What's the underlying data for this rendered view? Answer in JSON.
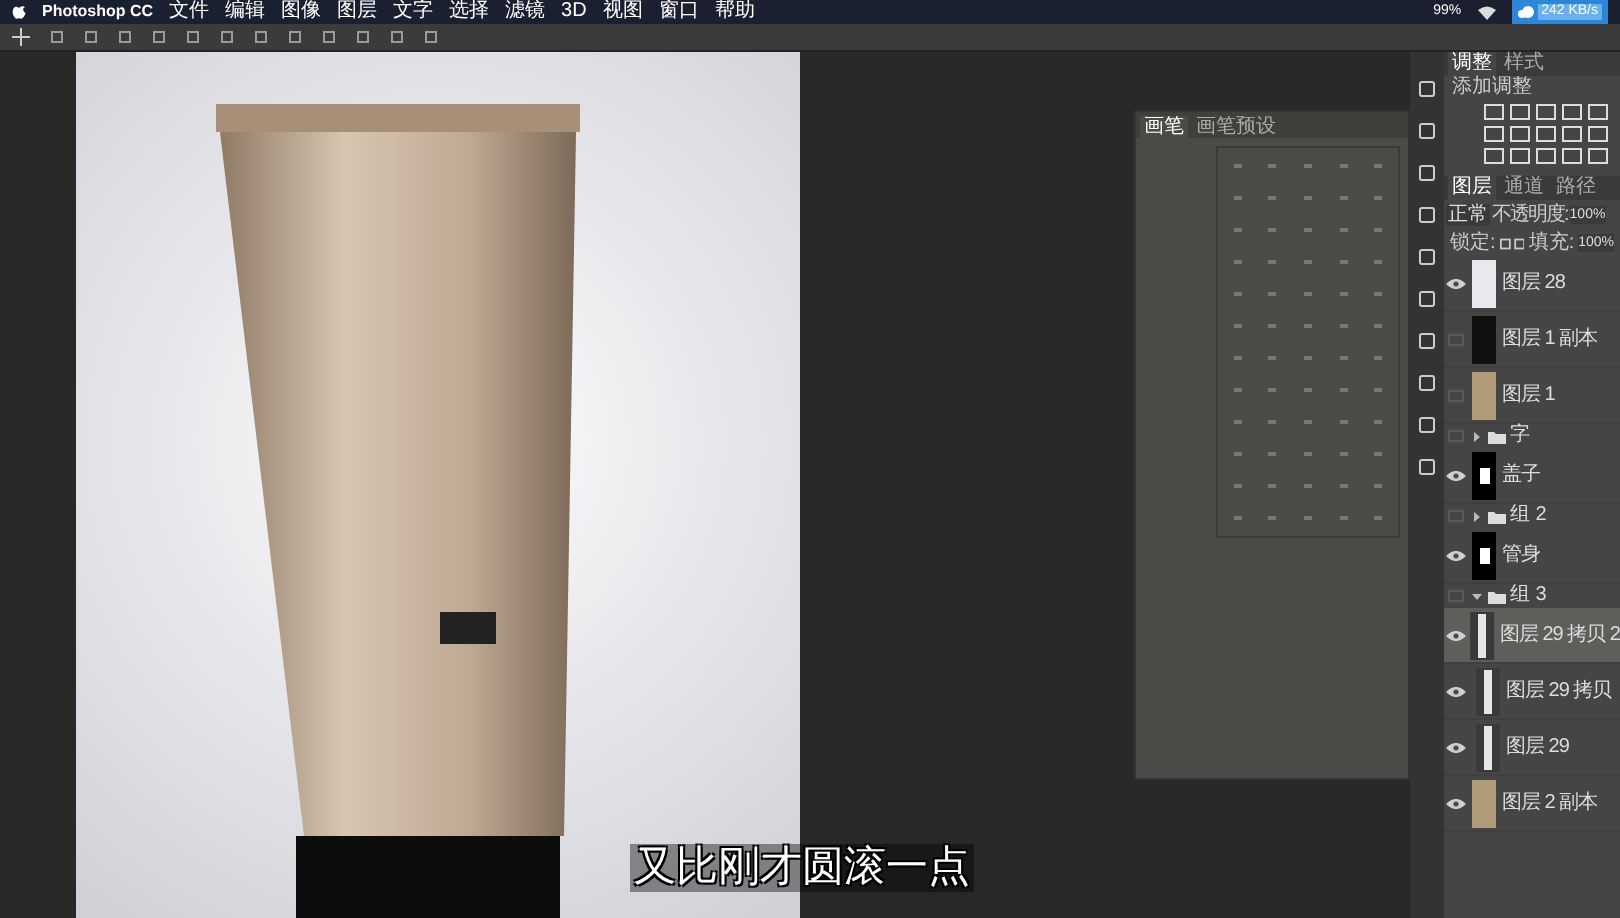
{
  "menu_bar": {
    "app": "Photoshop CC",
    "items": [
      "文件",
      "编辑",
      "图像",
      "图层",
      "文字",
      "选择",
      "滤镜",
      "3D",
      "视图",
      "窗口",
      "帮助"
    ],
    "battery": "99%",
    "speed": "242 KB/s"
  },
  "brush_panel": {
    "tabs": [
      {
        "label": "画笔",
        "selected": true
      },
      {
        "label": "画笔预设",
        "selected": false
      }
    ]
  },
  "adjustments": {
    "tabs": [
      {
        "label": "调整",
        "selected": true
      },
      {
        "label": "样式",
        "selected": false
      }
    ],
    "hint": "添加调整"
  },
  "layers_panel": {
    "tabs": [
      {
        "label": "图层",
        "selected": true
      },
      {
        "label": "通道",
        "selected": false
      },
      {
        "label": "路径",
        "selected": false
      }
    ],
    "blend_mode": "正常",
    "opacity_label": "不透明度:",
    "opacity": "100%",
    "lock_label": "锁定:",
    "fill_label": "填充:",
    "fill": "100%",
    "layers": [
      {
        "kind": "layer",
        "name": "图层 28",
        "visible": true,
        "selected": false,
        "thumbnail": {
          "kind": "light"
        }
      },
      {
        "kind": "layer",
        "name": "图层 1 副本",
        "visible": false,
        "selected": false,
        "thumbnail": {
          "kind": "dark"
        }
      },
      {
        "kind": "layer",
        "name": "图层 1",
        "visible": false,
        "selected": false,
        "thumbnail": {
          "kind": "photo"
        }
      },
      {
        "kind": "group",
        "name": "字",
        "visible": false,
        "selected": false,
        "expanded": false
      },
      {
        "kind": "layer",
        "name": "盖子",
        "visible": true,
        "selected": false,
        "thumbnail": {
          "kind": "mask"
        }
      },
      {
        "kind": "group",
        "name": "组 2",
        "visible": false,
        "selected": false,
        "expanded": false
      },
      {
        "kind": "layer",
        "name": "管身",
        "visible": true,
        "selected": false,
        "thumbnail": {
          "kind": "mask"
        }
      },
      {
        "kind": "group",
        "name": "组 3",
        "visible": false,
        "selected": false,
        "expanded": true,
        "children": [
          {
            "kind": "layer",
            "name": "图层 29 拷贝 2",
            "visible": true,
            "selected": true,
            "thumbnail": {
              "kind": "strip"
            }
          },
          {
            "kind": "layer",
            "name": "图层 29 拷贝",
            "visible": true,
            "selected": false,
            "thumbnail": {
              "kind": "strip"
            }
          },
          {
            "kind": "layer",
            "name": "图层 29",
            "visible": true,
            "selected": false,
            "thumbnail": {
              "kind": "strip"
            }
          }
        ]
      },
      {
        "kind": "layer",
        "name": "图层 2 副本",
        "visible": true,
        "selected": false,
        "thumbnail": {
          "kind": "photo"
        }
      }
    ]
  },
  "subtitle": "又比刚才圆滚一点"
}
